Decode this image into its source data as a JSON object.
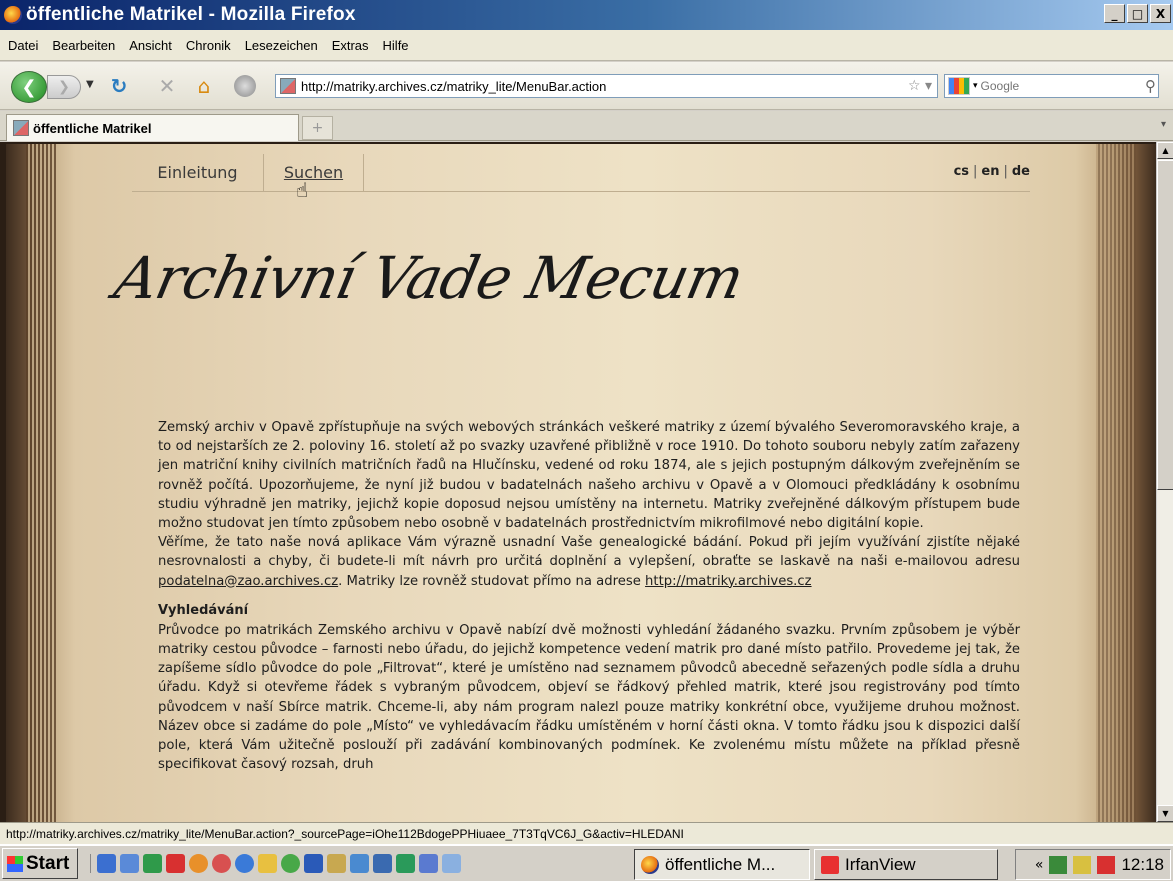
{
  "window": {
    "title": "öffentliche Matrikel - Mozilla Firefox",
    "controls": {
      "minimize": "_",
      "maximize": "□",
      "close": "X"
    }
  },
  "menubar": [
    "Datei",
    "Bearbeiten",
    "Ansicht",
    "Chronik",
    "Lesezeichen",
    "Extras",
    "Hilfe"
  ],
  "navbar": {
    "url": "http://matriky.archives.cz/matriky_lite/MenuBar.action",
    "search_placeholder": "Google",
    "icons": [
      "back-icon",
      "forward-icon",
      "reload-icon",
      "stop-icon",
      "home-icon",
      "throbber-icon",
      "bookmark-star-icon",
      "search-magnifier-icon"
    ]
  },
  "tabs": [
    {
      "label": "öffentliche Matrikel"
    }
  ],
  "page": {
    "nav": {
      "tab1": "Einleitung",
      "tab2": "Suchen"
    },
    "langs": {
      "cs": "cs",
      "en": "en",
      "de": "de",
      "sep": "|"
    },
    "logo_text": "Archivní Vade Mecum",
    "intro_part1": "Zemský archiv v Opavě zpřístupňuje na svých webových stránkách veškeré matriky z území bývalého Severomoravského kraje, a to od nejstarších ze 2. poloviny 16. století až po svazky uzavřené přibližně v roce 1910. Do tohoto souboru nebyly zatím zařazeny jen matriční knihy civilních matričních řadů na Hlučínsku, vedené od roku 1874, ale s jejich postupným dálkovým zveřejněním se rovněž počítá. Upozorňujeme, že nyní již budou v badatelnách našeho archivu v Opavě a v Olomouci předkládány k osobnímu studiu výhradně jen matriky, jejichž kopie doposud nejsou umístěny na internetu. Matriky zveřejněné dálkovým přístupem bude možno studovat jen tímto způsobem nebo osobně v badatelnách prostřednictvím mikrofilmové nebo digitální kopie.",
    "intro_part2": "Věříme, že tato naše nová aplikace Vám výrazně usnadní Vaše genealogické bádání. Pokud při jejím využívání zjistíte nějaké nesrovnalosti a chyby, či budete-li mít návrh pro určitá doplnění a vylepšení, obraťte se laskavě na naši e-mailovou adresu ",
    "email_link": "podatelna@zao.archives.cz",
    "intro_part3": ". Matriky lze rovněž studovat přímo na adrese ",
    "site_link": "http://matriky.archives.cz",
    "section_heading": "Vyhledávání",
    "section_text": "Průvodce po matrikách Zemského archivu v Opavě nabízí dvě možnosti vyhledání žádaného svazku. Prvním způsobem je výběr matriky cestou původce – farnosti nebo úřadu, do jejichž kompetence vedení matrik pro dané místo patřilo. Provedeme jej tak, že zapíšeme sídlo původce do pole „Filtrovat“, které je umístěno nad seznamem původců abecedně seřazených podle sídla a druhu úřadu. Když si otevřeme řádek s vybraným původcem, objeví se řádkový přehled matrik, které jsou registrovány pod tímto původcem v naší Sbírce matrik. Chceme-li, aby nám program nalezl pouze matriky konkrétní obce, využijeme druhou možnost. Název obce si zadáme do pole „Místo“ ve vyhledávacím řádku umístěném v horní části okna. V tomto řádku jsou k dispozici další pole, která Vám užitečně poslouží při zadávání kombinovaných podmínek. Ke zvolenému místu můžete na příklad přesně specifikovat časový rozsah, druh"
  },
  "statusbar": {
    "text": "http://matriky.archives.cz/matriky_lite/MenuBar.action?_sourcePage=iOhe112BdogePPHiuaee_7T3TqVC6J_G&activ=HLEDANI"
  },
  "taskbar": {
    "start_label": "Start",
    "tasks": [
      {
        "label": "öffentliche M...",
        "icon": "firefox-icon",
        "active": true
      },
      {
        "label": "IrfanView",
        "icon": "irfanview-icon",
        "active": false
      }
    ],
    "tray_chevron": "«",
    "clock": "12:18"
  }
}
